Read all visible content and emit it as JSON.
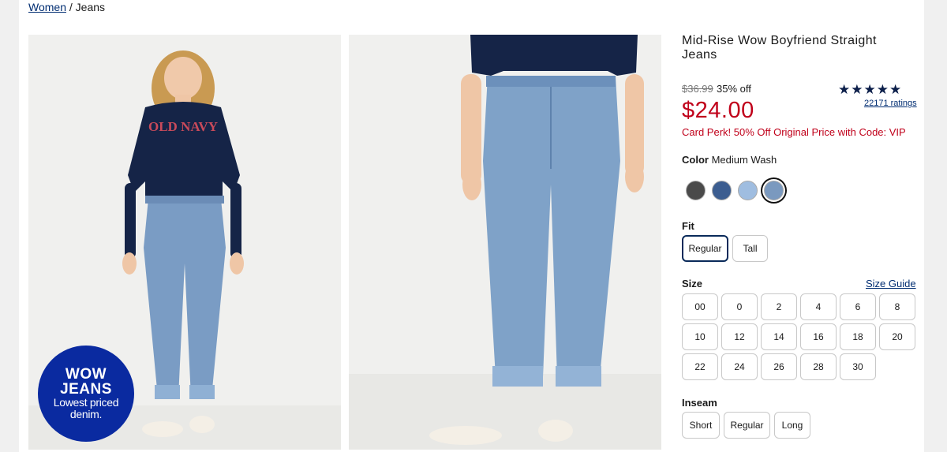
{
  "breadcrumb": {
    "parent": "Women",
    "separator": "/",
    "current": "Jeans"
  },
  "badge": {
    "line1": "WOW",
    "line2": "JEANS",
    "line3": "Lowest priced",
    "line4": "denim."
  },
  "product": {
    "title": "Mid-Rise Wow Boyfriend Straight Jeans",
    "original_price": "$36.99",
    "discount": "35% off",
    "price": "$24.00",
    "perk": "Card Perk! 50% Off Original Price with Code: VIP",
    "rating_stars": "★★★★★",
    "rating_value": 4.5,
    "ratings_count": "22171 ratings"
  },
  "color": {
    "label": "Color",
    "selected": "Medium Wash",
    "swatches": [
      "#4a4a4a",
      "#3c5d90",
      "#9fbde0",
      "#7a99bf"
    ]
  },
  "fit": {
    "label": "Fit",
    "options": [
      "Regular",
      "Tall"
    ],
    "selected": "Regular"
  },
  "size": {
    "label": "Size",
    "guide": "Size Guide",
    "options": [
      "00",
      "0",
      "2",
      "4",
      "6",
      "8",
      "10",
      "12",
      "14",
      "16",
      "18",
      "20",
      "22",
      "24",
      "26",
      "28",
      "30"
    ]
  },
  "inseam": {
    "label": "Inseam",
    "options": [
      "Short",
      "Regular",
      "Long"
    ]
  },
  "colors": {
    "accent_red": "#c0001a",
    "navy": "#002d72",
    "badge_blue": "#0a2aa0"
  }
}
